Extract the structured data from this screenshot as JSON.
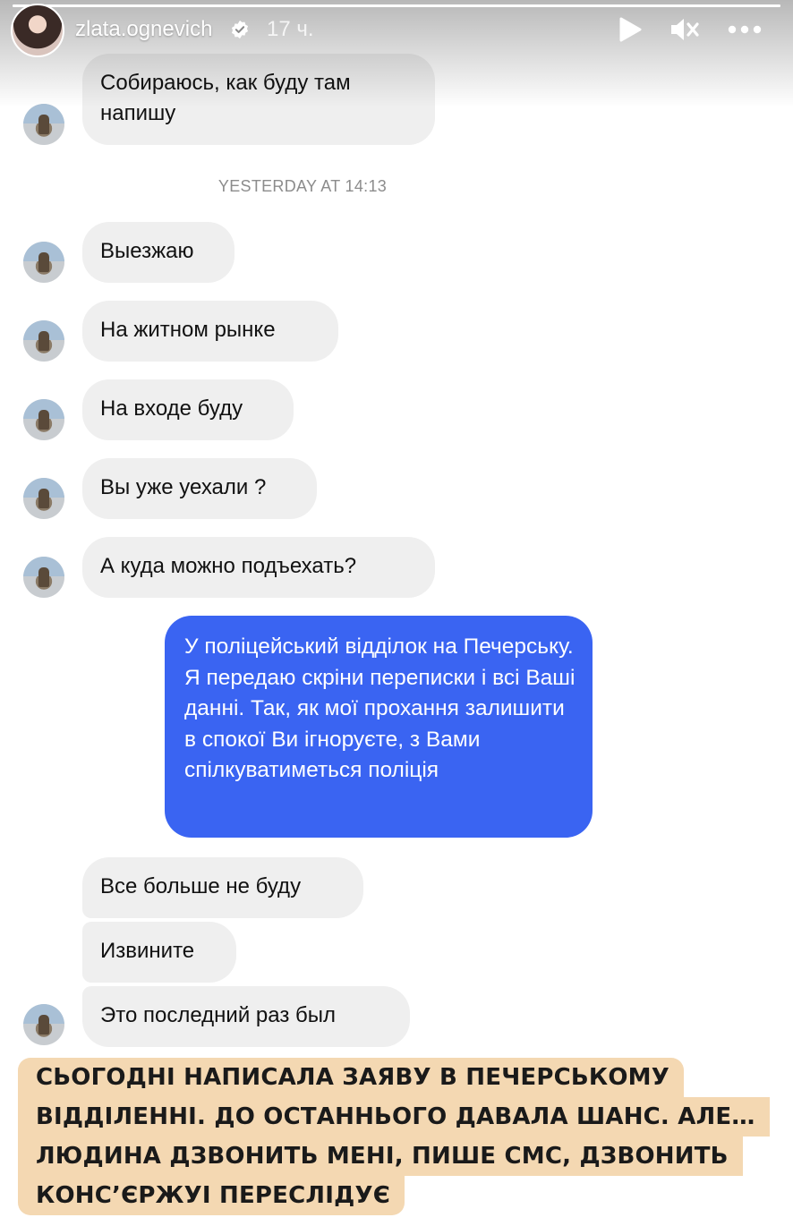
{
  "story": {
    "username": "zlata.ognevich",
    "time_ago": "17 ч.",
    "progress": 1.0,
    "accent_colors": {
      "outgoing_bubble": "#3a64f2",
      "incoming_bubble": "#efefef",
      "caption_bg": "#f4d8b2"
    },
    "icons": [
      "verified-badge-icon",
      "play-icon",
      "mute-icon",
      "more-icon"
    ]
  },
  "chat": {
    "timestamp": "YESTERDAY AT 14:13",
    "messages": [
      {
        "side": "in",
        "text": "Собираюсь, как буду там напишу"
      },
      {
        "side": "in",
        "text": "Выезжаю"
      },
      {
        "side": "in",
        "text": "На житном рынке"
      },
      {
        "side": "in",
        "text": "На входе буду"
      },
      {
        "side": "in",
        "text": "Вы уже уехали ?"
      },
      {
        "side": "in",
        "text": "А куда можно подъехать?"
      },
      {
        "side": "out",
        "text": "У поліцейський відділок на Печерську. Я передаю скріни переписки і всі Ваші данні. Так, як мої прохання залишити в спокої Ви ігноруєте, з Вами спілкуватиметься поліція"
      },
      {
        "side": "in",
        "text": "Все больше не буду"
      },
      {
        "side": "in",
        "text": "Извините"
      },
      {
        "side": "in",
        "text": "Это последний раз был"
      }
    ]
  },
  "caption": {
    "lines": [
      "СЬОГОДНІ НАПИСАЛА ЗАЯВУ В ПЕЧЕРСЬКОМУ",
      "ВІДДІЛЕННІ. ДО ОСТАННЬОГО ДАВАЛА ШАНС. АЛЕ…",
      "ЛЮДИНА ДЗВОНИТЬ МЕНІ, ПИШЕ СМС, ДЗВОНИТЬ",
      "КОНС’ЄРЖУІ ПЕРЕСЛІДУЄ"
    ]
  }
}
